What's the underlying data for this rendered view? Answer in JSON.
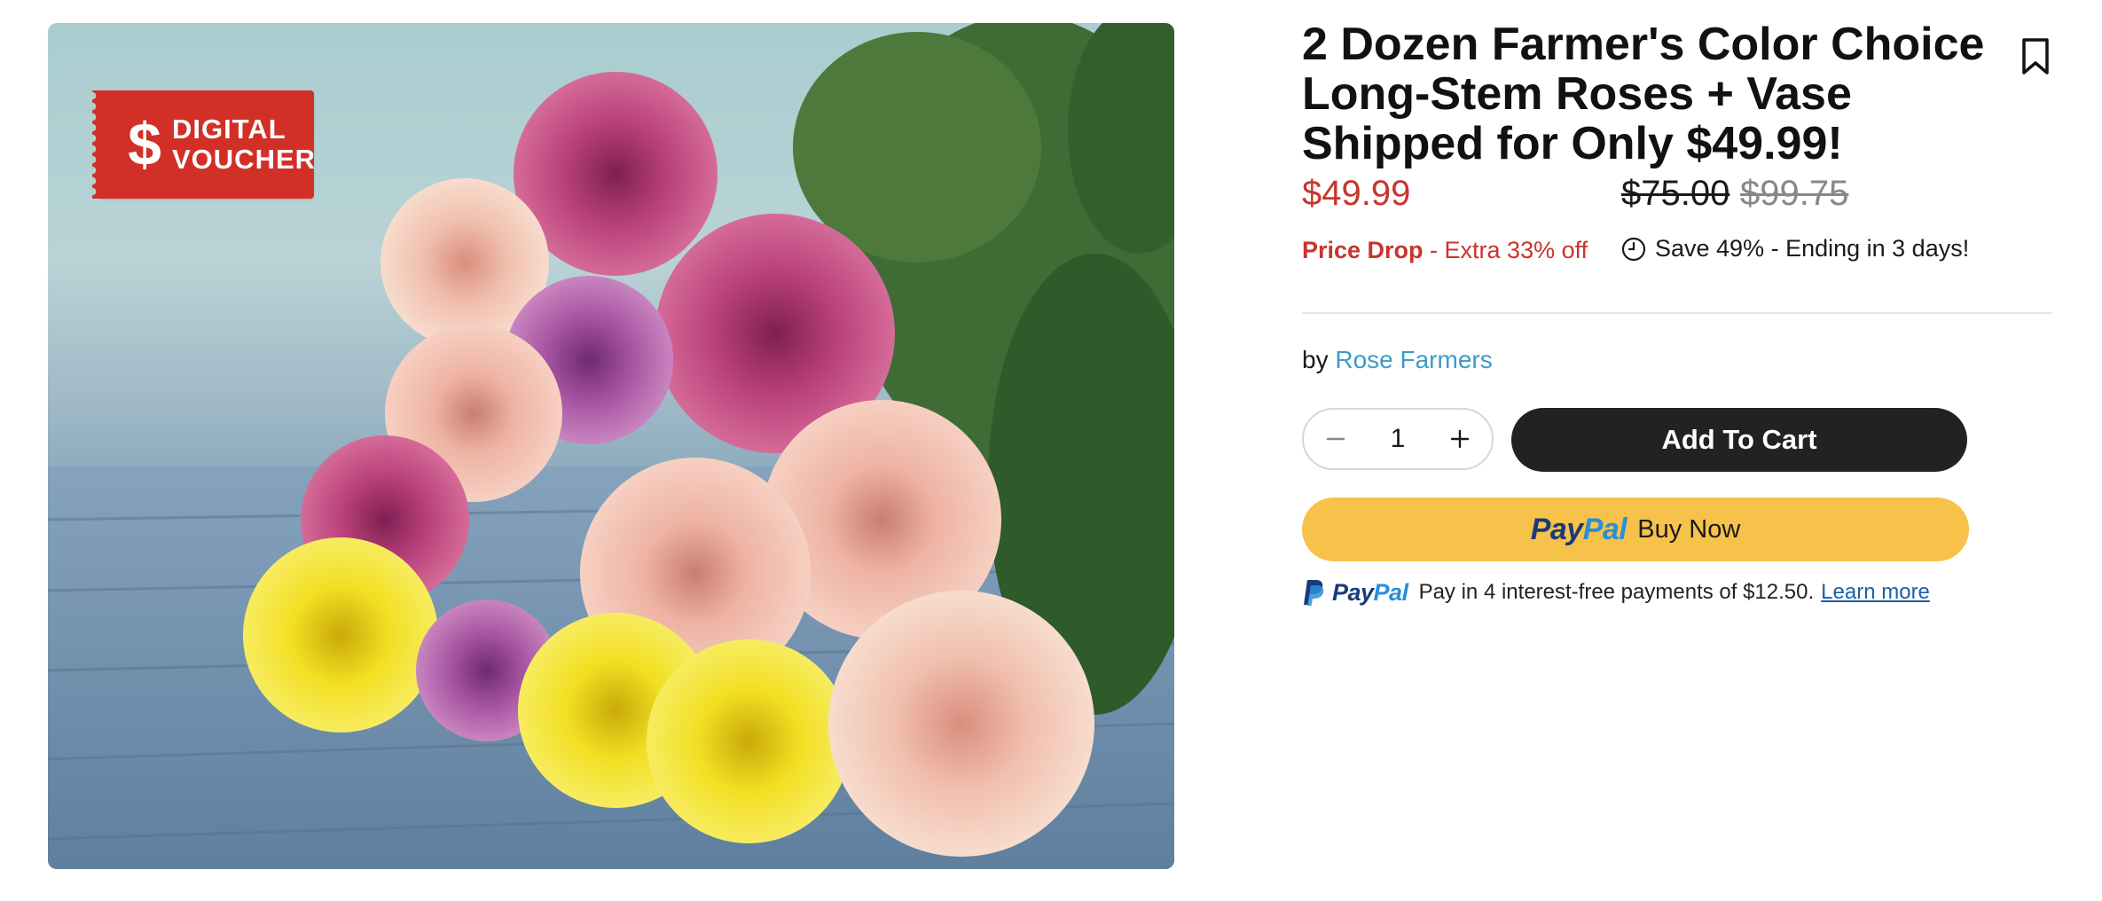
{
  "image": {
    "badge": {
      "icon": "dollar-sign-icon",
      "symbol": "$",
      "line1": "DIGITAL",
      "line2": "VOUCHER",
      "color": "#d22f27"
    }
  },
  "product": {
    "title": "2 Dozen Farmer's Color Choice Long-Stem Roses + Vase Shipped for Only $49.99!",
    "bookmark_icon": "bookmark-icon"
  },
  "pricing": {
    "current": "$49.99",
    "original": "$75.00",
    "compare": "$99.75",
    "drop_label": "Price Drop",
    "drop_detail": " - Extra 33% off",
    "save_icon": "clock-icon",
    "save_text": "Save 49% - Ending in 3 days!",
    "colors": {
      "sale": "#c8352c",
      "muted": "#888888"
    }
  },
  "vendor": {
    "prefix": "by ",
    "name": "Rose Farmers",
    "color": "#3e9bc7"
  },
  "cart": {
    "quantity": "1",
    "decrement_icon": "minus-icon",
    "increment_icon": "plus-icon",
    "add_label": "Add To Cart"
  },
  "paypal": {
    "brand_pay": "Pay",
    "brand_pal": "Pal",
    "buy_label": "Buy Now",
    "paylater_text": "Pay in 4 interest-free payments of $12.50.",
    "learn_more": "Learn more",
    "button_color": "#f7c24a"
  }
}
